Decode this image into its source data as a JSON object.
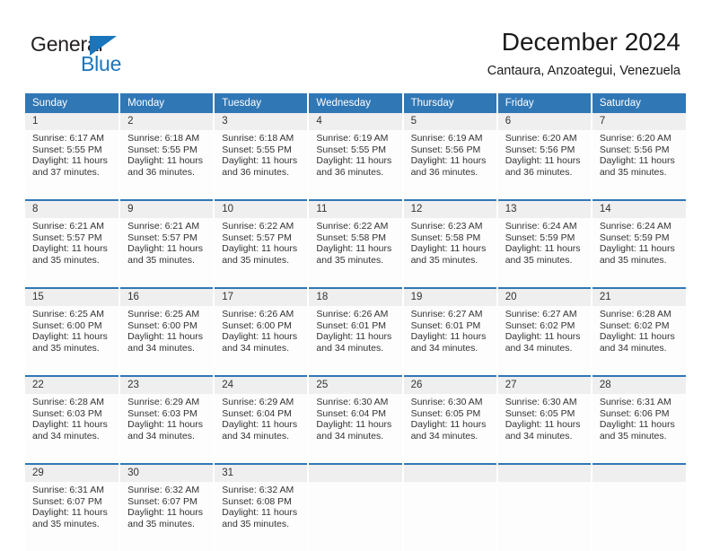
{
  "logo": {
    "word_one": "General",
    "word_two": "Blue",
    "triangle_icon": "blue-triangle-icon",
    "accent_color": "#1a76bc"
  },
  "header": {
    "month_title": "December 2024",
    "location": "Cantaura, Anzoategui, Venezuela"
  },
  "theme": {
    "header_blue": "#3077b5",
    "daynum_gray": "#efefef",
    "cell_white": "#fdfdfd",
    "text_dark": "#333333"
  },
  "calendar": {
    "weekday_headers": [
      "Sunday",
      "Monday",
      "Tuesday",
      "Wednesday",
      "Thursday",
      "Friday",
      "Saturday"
    ],
    "weeks": [
      {
        "daynums": [
          "1",
          "2",
          "3",
          "4",
          "5",
          "6",
          "7"
        ],
        "cells": [
          {
            "sunrise": "Sunrise: 6:17 AM",
            "sunset": "Sunset: 5:55 PM",
            "daylight_1": "Daylight: 11 hours",
            "daylight_2": "and 37 minutes."
          },
          {
            "sunrise": "Sunrise: 6:18 AM",
            "sunset": "Sunset: 5:55 PM",
            "daylight_1": "Daylight: 11 hours",
            "daylight_2": "and 36 minutes."
          },
          {
            "sunrise": "Sunrise: 6:18 AM",
            "sunset": "Sunset: 5:55 PM",
            "daylight_1": "Daylight: 11 hours",
            "daylight_2": "and 36 minutes."
          },
          {
            "sunrise": "Sunrise: 6:19 AM",
            "sunset": "Sunset: 5:55 PM",
            "daylight_1": "Daylight: 11 hours",
            "daylight_2": "and 36 minutes."
          },
          {
            "sunrise": "Sunrise: 6:19 AM",
            "sunset": "Sunset: 5:56 PM",
            "daylight_1": "Daylight: 11 hours",
            "daylight_2": "and 36 minutes."
          },
          {
            "sunrise": "Sunrise: 6:20 AM",
            "sunset": "Sunset: 5:56 PM",
            "daylight_1": "Daylight: 11 hours",
            "daylight_2": "and 36 minutes."
          },
          {
            "sunrise": "Sunrise: 6:20 AM",
            "sunset": "Sunset: 5:56 PM",
            "daylight_1": "Daylight: 11 hours",
            "daylight_2": "and 35 minutes."
          }
        ]
      },
      {
        "daynums": [
          "8",
          "9",
          "10",
          "11",
          "12",
          "13",
          "14"
        ],
        "cells": [
          {
            "sunrise": "Sunrise: 6:21 AM",
            "sunset": "Sunset: 5:57 PM",
            "daylight_1": "Daylight: 11 hours",
            "daylight_2": "and 35 minutes."
          },
          {
            "sunrise": "Sunrise: 6:21 AM",
            "sunset": "Sunset: 5:57 PM",
            "daylight_1": "Daylight: 11 hours",
            "daylight_2": "and 35 minutes."
          },
          {
            "sunrise": "Sunrise: 6:22 AM",
            "sunset": "Sunset: 5:57 PM",
            "daylight_1": "Daylight: 11 hours",
            "daylight_2": "and 35 minutes."
          },
          {
            "sunrise": "Sunrise: 6:22 AM",
            "sunset": "Sunset: 5:58 PM",
            "daylight_1": "Daylight: 11 hours",
            "daylight_2": "and 35 minutes."
          },
          {
            "sunrise": "Sunrise: 6:23 AM",
            "sunset": "Sunset: 5:58 PM",
            "daylight_1": "Daylight: 11 hours",
            "daylight_2": "and 35 minutes."
          },
          {
            "sunrise": "Sunrise: 6:24 AM",
            "sunset": "Sunset: 5:59 PM",
            "daylight_1": "Daylight: 11 hours",
            "daylight_2": "and 35 minutes."
          },
          {
            "sunrise": "Sunrise: 6:24 AM",
            "sunset": "Sunset: 5:59 PM",
            "daylight_1": "Daylight: 11 hours",
            "daylight_2": "and 35 minutes."
          }
        ]
      },
      {
        "daynums": [
          "15",
          "16",
          "17",
          "18",
          "19",
          "20",
          "21"
        ],
        "cells": [
          {
            "sunrise": "Sunrise: 6:25 AM",
            "sunset": "Sunset: 6:00 PM",
            "daylight_1": "Daylight: 11 hours",
            "daylight_2": "and 35 minutes."
          },
          {
            "sunrise": "Sunrise: 6:25 AM",
            "sunset": "Sunset: 6:00 PM",
            "daylight_1": "Daylight: 11 hours",
            "daylight_2": "and 34 minutes."
          },
          {
            "sunrise": "Sunrise: 6:26 AM",
            "sunset": "Sunset: 6:00 PM",
            "daylight_1": "Daylight: 11 hours",
            "daylight_2": "and 34 minutes."
          },
          {
            "sunrise": "Sunrise: 6:26 AM",
            "sunset": "Sunset: 6:01 PM",
            "daylight_1": "Daylight: 11 hours",
            "daylight_2": "and 34 minutes."
          },
          {
            "sunrise": "Sunrise: 6:27 AM",
            "sunset": "Sunset: 6:01 PM",
            "daylight_1": "Daylight: 11 hours",
            "daylight_2": "and 34 minutes."
          },
          {
            "sunrise": "Sunrise: 6:27 AM",
            "sunset": "Sunset: 6:02 PM",
            "daylight_1": "Daylight: 11 hours",
            "daylight_2": "and 34 minutes."
          },
          {
            "sunrise": "Sunrise: 6:28 AM",
            "sunset": "Sunset: 6:02 PM",
            "daylight_1": "Daylight: 11 hours",
            "daylight_2": "and 34 minutes."
          }
        ]
      },
      {
        "daynums": [
          "22",
          "23",
          "24",
          "25",
          "26",
          "27",
          "28"
        ],
        "cells": [
          {
            "sunrise": "Sunrise: 6:28 AM",
            "sunset": "Sunset: 6:03 PM",
            "daylight_1": "Daylight: 11 hours",
            "daylight_2": "and 34 minutes."
          },
          {
            "sunrise": "Sunrise: 6:29 AM",
            "sunset": "Sunset: 6:03 PM",
            "daylight_1": "Daylight: 11 hours",
            "daylight_2": "and 34 minutes."
          },
          {
            "sunrise": "Sunrise: 6:29 AM",
            "sunset": "Sunset: 6:04 PM",
            "daylight_1": "Daylight: 11 hours",
            "daylight_2": "and 34 minutes."
          },
          {
            "sunrise": "Sunrise: 6:30 AM",
            "sunset": "Sunset: 6:04 PM",
            "daylight_1": "Daylight: 11 hours",
            "daylight_2": "and 34 minutes."
          },
          {
            "sunrise": "Sunrise: 6:30 AM",
            "sunset": "Sunset: 6:05 PM",
            "daylight_1": "Daylight: 11 hours",
            "daylight_2": "and 34 minutes."
          },
          {
            "sunrise": "Sunrise: 6:30 AM",
            "sunset": "Sunset: 6:05 PM",
            "daylight_1": "Daylight: 11 hours",
            "daylight_2": "and 34 minutes."
          },
          {
            "sunrise": "Sunrise: 6:31 AM",
            "sunset": "Sunset: 6:06 PM",
            "daylight_1": "Daylight: 11 hours",
            "daylight_2": "and 35 minutes."
          }
        ]
      },
      {
        "daynums": [
          "29",
          "30",
          "31",
          "",
          "",
          "",
          ""
        ],
        "cells": [
          {
            "sunrise": "Sunrise: 6:31 AM",
            "sunset": "Sunset: 6:07 PM",
            "daylight_1": "Daylight: 11 hours",
            "daylight_2": "and 35 minutes."
          },
          {
            "sunrise": "Sunrise: 6:32 AM",
            "sunset": "Sunset: 6:07 PM",
            "daylight_1": "Daylight: 11 hours",
            "daylight_2": "and 35 minutes."
          },
          {
            "sunrise": "Sunrise: 6:32 AM",
            "sunset": "Sunset: 6:08 PM",
            "daylight_1": "Daylight: 11 hours",
            "daylight_2": "and 35 minutes."
          },
          {
            "sunrise": "",
            "sunset": "",
            "daylight_1": "",
            "daylight_2": ""
          },
          {
            "sunrise": "",
            "sunset": "",
            "daylight_1": "",
            "daylight_2": ""
          },
          {
            "sunrise": "",
            "sunset": "",
            "daylight_1": "",
            "daylight_2": ""
          },
          {
            "sunrise": "",
            "sunset": "",
            "daylight_1": "",
            "daylight_2": ""
          }
        ]
      }
    ]
  }
}
